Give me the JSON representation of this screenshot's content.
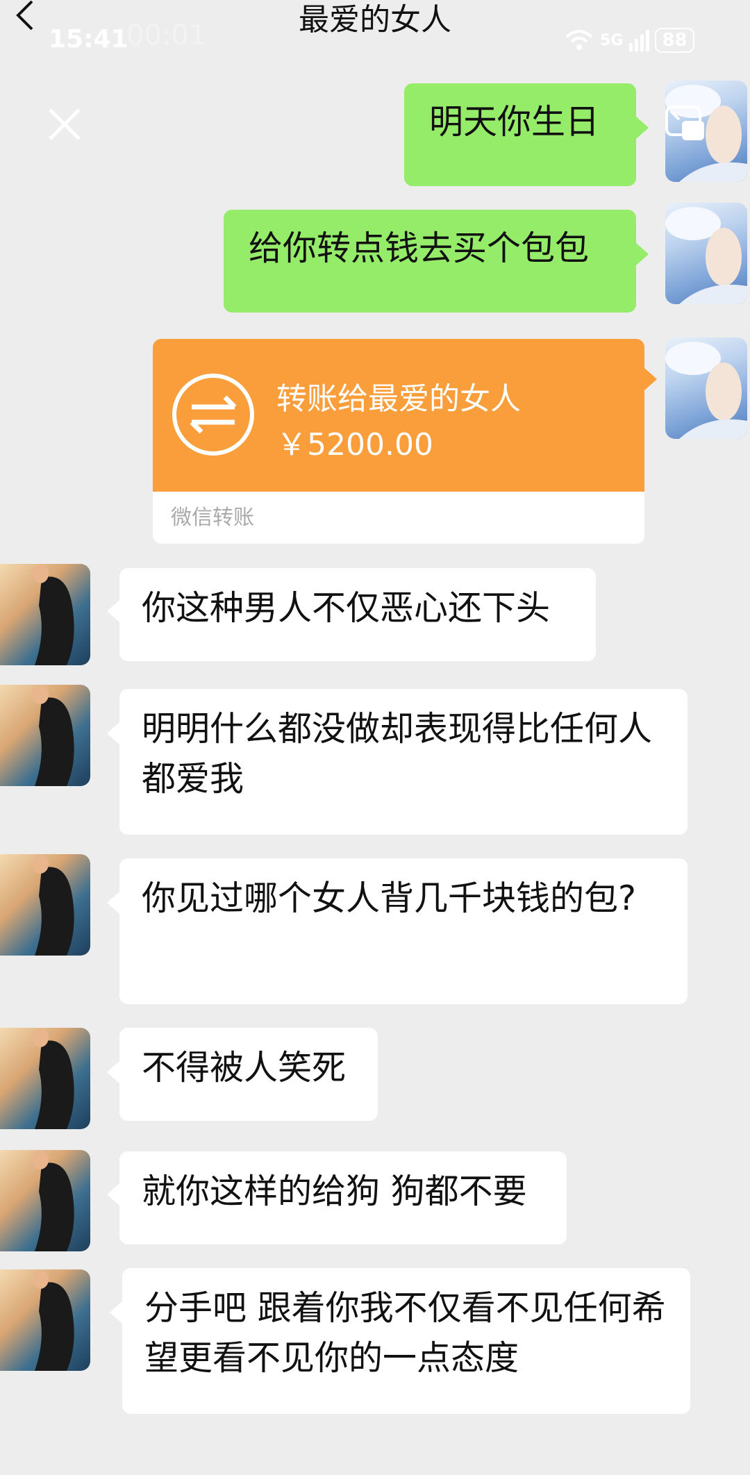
{
  "header": {
    "title": "最爱的女人"
  },
  "status_bar": {
    "time": "15:41",
    "time_ghost": "00:01",
    "network": "5G",
    "battery": "88"
  },
  "icons": {
    "back": "chevron-left-icon",
    "close": "close-icon",
    "pip": "floating-window-icon",
    "transfer": "transfer-arrows-icon"
  },
  "messages": [
    {
      "sender": "me",
      "text": "明天你生日"
    },
    {
      "sender": "me",
      "text": "给你转点钱去买个包包"
    },
    {
      "sender": "me",
      "type": "transfer",
      "title": "转账给最爱的女人",
      "amount": "￥5200.00",
      "footer": "微信转账"
    },
    {
      "sender": "her",
      "text": "你这种男人不仅恶心还下头"
    },
    {
      "sender": "her",
      "text": "明明什么都没做却表现得比任何人都爱我"
    },
    {
      "sender": "her",
      "text": "你见过哪个女人背几千块钱的包?"
    },
    {
      "sender": "her",
      "text": "不得被人笑死"
    },
    {
      "sender": "her",
      "text": "就你这样的给狗 狗都不要"
    },
    {
      "sender": "her",
      "text": "分手吧 跟着你我不仅看不见任何希望更看不见你的一点态度"
    }
  ],
  "colors": {
    "background": "#ededed",
    "my_bubble": "#95ec69",
    "her_bubble": "#ffffff",
    "transfer": "#fa9d3b"
  }
}
